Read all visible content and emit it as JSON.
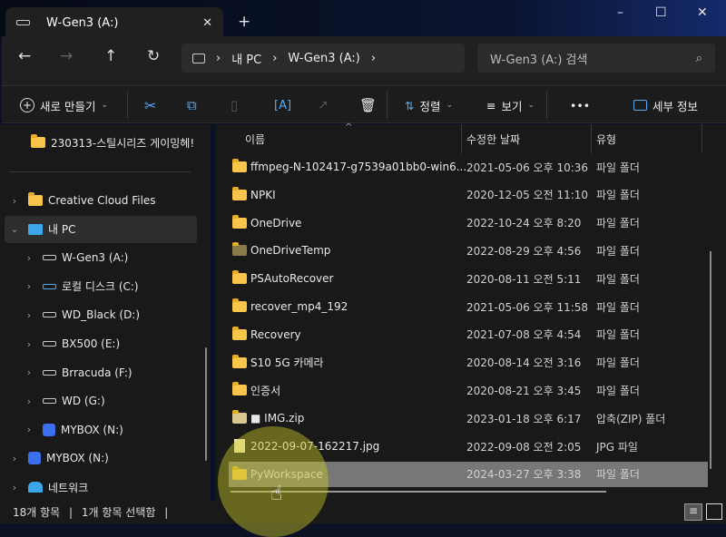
{
  "window": {
    "tab_title": "W-Gen3 (A:)",
    "new_tab": "+",
    "minimize": "–",
    "maximize": "☐",
    "close": "✕",
    "tab_close": "✕"
  },
  "nav": {
    "back": "←",
    "forward": "→",
    "up": "↑",
    "refresh": "↻"
  },
  "breadcrumb": [
    "내 PC",
    "W-Gen3 (A:)"
  ],
  "search": {
    "placeholder": "W-Gen3 (A:) 검색"
  },
  "toolbar": {
    "new": "새로 만들기",
    "sort": "정렬",
    "view": "보기",
    "more": "•••",
    "details": "세부 정보"
  },
  "sidebar": {
    "pinned": "230313-스틸시리즈 게이밍헤!",
    "items": [
      {
        "label": "Creative Cloud Files",
        "icon": "creative-cloud-icon"
      },
      {
        "label": "내 PC",
        "icon": "pc-icon"
      },
      {
        "label": "W-Gen3 (A:)",
        "icon": "drive-icon"
      },
      {
        "label": "로컬 디스크 (C:)",
        "icon": "system-drive-icon"
      },
      {
        "label": "WD_Black (D:)",
        "icon": "drive-icon"
      },
      {
        "label": "BX500 (E:)",
        "icon": "drive-icon"
      },
      {
        "label": "Brracuda (F:)",
        "icon": "drive-icon"
      },
      {
        "label": "WD (G:)",
        "icon": "drive-icon"
      },
      {
        "label": "MYBOX (N:)",
        "icon": "mybox-icon"
      },
      {
        "label": "MYBOX (N:)",
        "icon": "mybox-icon"
      },
      {
        "label": "네트워크",
        "icon": "network-icon"
      }
    ]
  },
  "columns": {
    "name": "이름",
    "date": "수정한 날짜",
    "type": "유형"
  },
  "files": [
    {
      "name": "ffmpeg-N-102417-g7539a01bb0-win6...",
      "date": "2021-05-06 오후 10:36",
      "type": "파일 폴더"
    },
    {
      "name": "NPKI",
      "date": "2020-12-05 오전 11:10",
      "type": "파일 폴더"
    },
    {
      "name": "OneDrive",
      "date": "2022-10-24 오후 8:20",
      "type": "파일 폴더"
    },
    {
      "name": "OneDriveTemp",
      "date": "2022-08-29 오후 4:56",
      "type": "파일 폴더"
    },
    {
      "name": "PSAutoRecover",
      "date": "2020-08-11 오전 5:11",
      "type": "파일 폴더"
    },
    {
      "name": "recover_mp4_192",
      "date": "2021-05-06 오후 11:58",
      "type": "파일 폴더"
    },
    {
      "name": "Recovery",
      "date": "2021-07-08 오후 4:54",
      "type": "파일 폴더"
    },
    {
      "name": "S10 5G 카메라",
      "date": "2020-08-14 오전 3:16",
      "type": "파일 폴더"
    },
    {
      "name": "인증서",
      "date": "2020-08-21 오후 3:45",
      "type": "파일 폴더"
    },
    {
      "name": "■ IMG.zip",
      "date": "2023-01-18 오후 6:17",
      "type": "압축(ZIP) 폴더"
    },
    {
      "name": "2022-09-07-162217.jpg",
      "date": "2022-09-08 오전 2:05",
      "type": "JPG 파일"
    },
    {
      "name": "PyWorkspace",
      "date": "2024-03-27 오후 3:38",
      "type": "파일 폴더"
    }
  ],
  "status": {
    "count": "18개 항목",
    "selected": "1개 항목 선택함"
  }
}
